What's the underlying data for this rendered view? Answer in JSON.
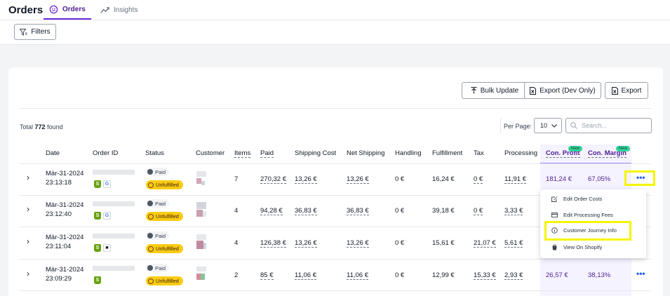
{
  "app": {
    "title": "Orders",
    "tabs": [
      {
        "label": "Orders",
        "icon": "orders-icon",
        "active": true
      },
      {
        "label": "Insights",
        "icon": "trend-icon",
        "active": false
      }
    ]
  },
  "toolbar": {
    "filters_label": "Filters"
  },
  "actions": {
    "bulk_update": "Bulk Update",
    "export_dev": "Export (Dev Only)",
    "export": "Export"
  },
  "summary": {
    "total_prefix": "Total",
    "total_count": "772",
    "total_suffix": "found"
  },
  "pagination": {
    "per_page_label": "Per Page:",
    "per_page_value": "10"
  },
  "search": {
    "placeholder": "Search..."
  },
  "table": {
    "columns": {
      "date": "Date",
      "order_id": "Order ID",
      "status": "Status",
      "customer": "Customer",
      "items": "Items",
      "paid": "Paid",
      "shipping_cost": "Shipping Cost",
      "net_shipping": "Net Shipping",
      "handling": "Handling",
      "fulfillment": "Fulfillment",
      "tax": "Tax",
      "processing": "Processing F",
      "con_profit": "Con. Profit",
      "con_margin": "Con. Margin",
      "new_badge": "New"
    },
    "rows": [
      {
        "date": "Mär-31-2024",
        "time": "23:13:18",
        "paid_status": "Paid",
        "fulfillment_status": "Unfulfilled",
        "items": "7",
        "paid": "270,32 €",
        "shipping_cost": "13,26 €",
        "net_shipping": "13,26 €",
        "handling": "0 €",
        "fulfillment": "16,24 €",
        "tax": "0 €",
        "processing": "11,91 €",
        "con_profit": "181,24 €",
        "con_margin": "67,05%"
      },
      {
        "date": "Mär-31-2024",
        "time": "23:12:40",
        "paid_status": "Paid",
        "fulfillment_status": "Unfulfilled",
        "items": "4",
        "paid": "94,28 €",
        "shipping_cost": "36,83 €",
        "net_shipping": "36,83 €",
        "handling": "0 €",
        "fulfillment": "39,18 €",
        "tax": "0 €",
        "processing": "3,33 €",
        "con_profit": "",
        "con_margin": ""
      },
      {
        "date": "Mär-31-2024",
        "time": "23:11:04",
        "paid_status": "Paid",
        "fulfillment_status": "Unfulfilled",
        "items": "4",
        "paid": "126,38 €",
        "shipping_cost": "13,26 €",
        "net_shipping": "13,26 €",
        "handling": "0 €",
        "fulfillment": "15,61 €",
        "tax": "21,07 €",
        "processing": "5,61 €",
        "con_profit": "",
        "con_margin": ""
      },
      {
        "date": "Mär-31-2024",
        "time": "23:09:29",
        "paid_status": "Paid",
        "fulfillment_status": "Unfulfilled",
        "items": "2",
        "paid": "85 €",
        "shipping_cost": "11,06 €",
        "net_shipping": "11,06 €",
        "handling": "0 €",
        "fulfillment": "12,99 €",
        "tax": "15,33 €",
        "processing": "2,93 €",
        "con_profit": "26,57 €",
        "con_margin": "38,13%"
      }
    ]
  },
  "row_menu": {
    "items": [
      {
        "label": "Edit Order Costs",
        "icon": "edit-icon"
      },
      {
        "label": "Edit Processing Fees",
        "icon": "card-icon"
      },
      {
        "label": "Customer Journey Info",
        "icon": "info-icon"
      },
      {
        "label": "View On Shopify",
        "icon": "shopify-bag-icon"
      }
    ]
  },
  "colors": {
    "accent": "#6d28d9",
    "unfulfilled": "#facc15",
    "highlight": "#f5f500",
    "new_badge": "#34d399"
  }
}
